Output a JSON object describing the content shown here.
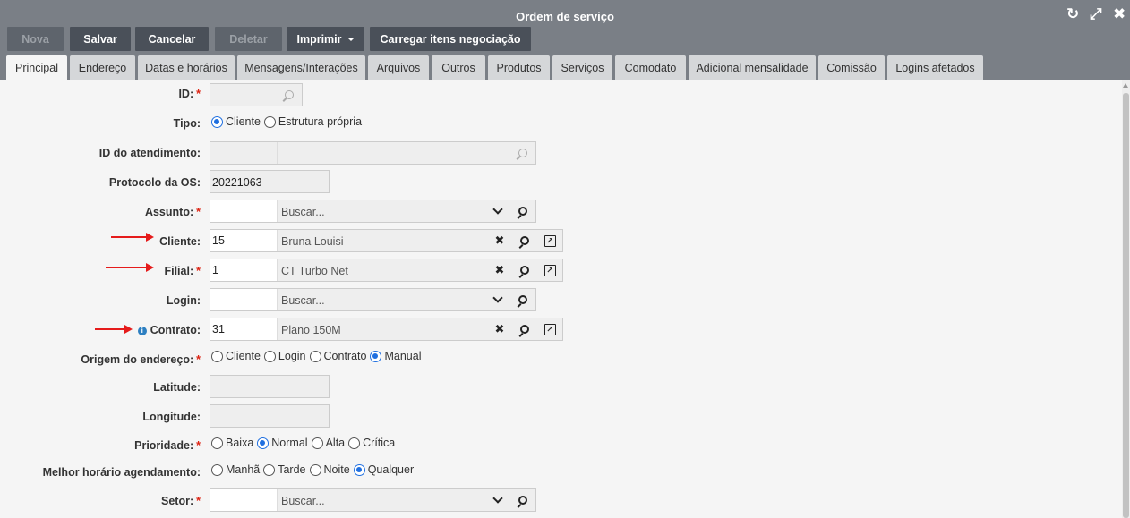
{
  "window": {
    "title": "Ordem de serviço",
    "controls": {
      "history": "↻",
      "expand": "⤢",
      "close": "✖"
    }
  },
  "toolbar": {
    "nova": "Nova",
    "salvar": "Salvar",
    "cancelar": "Cancelar",
    "deletar": "Deletar",
    "imprimir": "Imprimir",
    "carregar": "Carregar itens negociação"
  },
  "tabs": [
    "Principal",
    "Endereço",
    "Datas e horários",
    "Mensagens/Interações",
    "Arquivos",
    "Outros",
    "Produtos",
    "Serviços",
    "Comodato",
    "Adicional mensalidade",
    "Comissão",
    "Logins afetados"
  ],
  "form": {
    "id": {
      "label": "ID:",
      "value": ""
    },
    "tipo": {
      "label": "Tipo:",
      "options": [
        "Cliente",
        "Estrutura própria"
      ],
      "selected": "Cliente"
    },
    "id_atendimento": {
      "label": "ID do atendimento:",
      "value": ""
    },
    "protocolo": {
      "label": "Protocolo da OS:",
      "value": "20221063"
    },
    "assunto": {
      "label": "Assunto:",
      "code": "",
      "placeholder": "Buscar..."
    },
    "cliente": {
      "label": "Cliente:",
      "code": "15",
      "name": "Bruna Louisi"
    },
    "filial": {
      "label": "Filial:",
      "code": "1",
      "name": "CT Turbo Net"
    },
    "login": {
      "label": "Login:",
      "code": "",
      "placeholder": "Buscar..."
    },
    "contrato": {
      "label": "Contrato:",
      "code": "31",
      "name": "Plano 150M",
      "info_icon": "i"
    },
    "origem": {
      "label": "Origem do endereço:",
      "options": [
        "Cliente",
        "Login",
        "Contrato",
        "Manual"
      ],
      "selected": "Manual"
    },
    "latitude": {
      "label": "Latitude:",
      "value": ""
    },
    "longitude": {
      "label": "Longitude:",
      "value": ""
    },
    "prioridade": {
      "label": "Prioridade:",
      "options": [
        "Baixa",
        "Normal",
        "Alta",
        "Crítica"
      ],
      "selected": "Normal"
    },
    "melhor_horario": {
      "label": "Melhor horário agendamento:",
      "options": [
        "Manhã",
        "Tarde",
        "Noite",
        "Qualquer"
      ],
      "selected": "Qualquer"
    },
    "setor": {
      "label": "Setor:",
      "code": "",
      "placeholder": "Buscar..."
    },
    "required_mark": "*"
  },
  "colors": {
    "titlebar": "#7a7f86",
    "button": "#4a5059",
    "radio_selected": "#1f6fe0",
    "required": "#d21111",
    "annotation_arrow": "#e51b1b"
  }
}
